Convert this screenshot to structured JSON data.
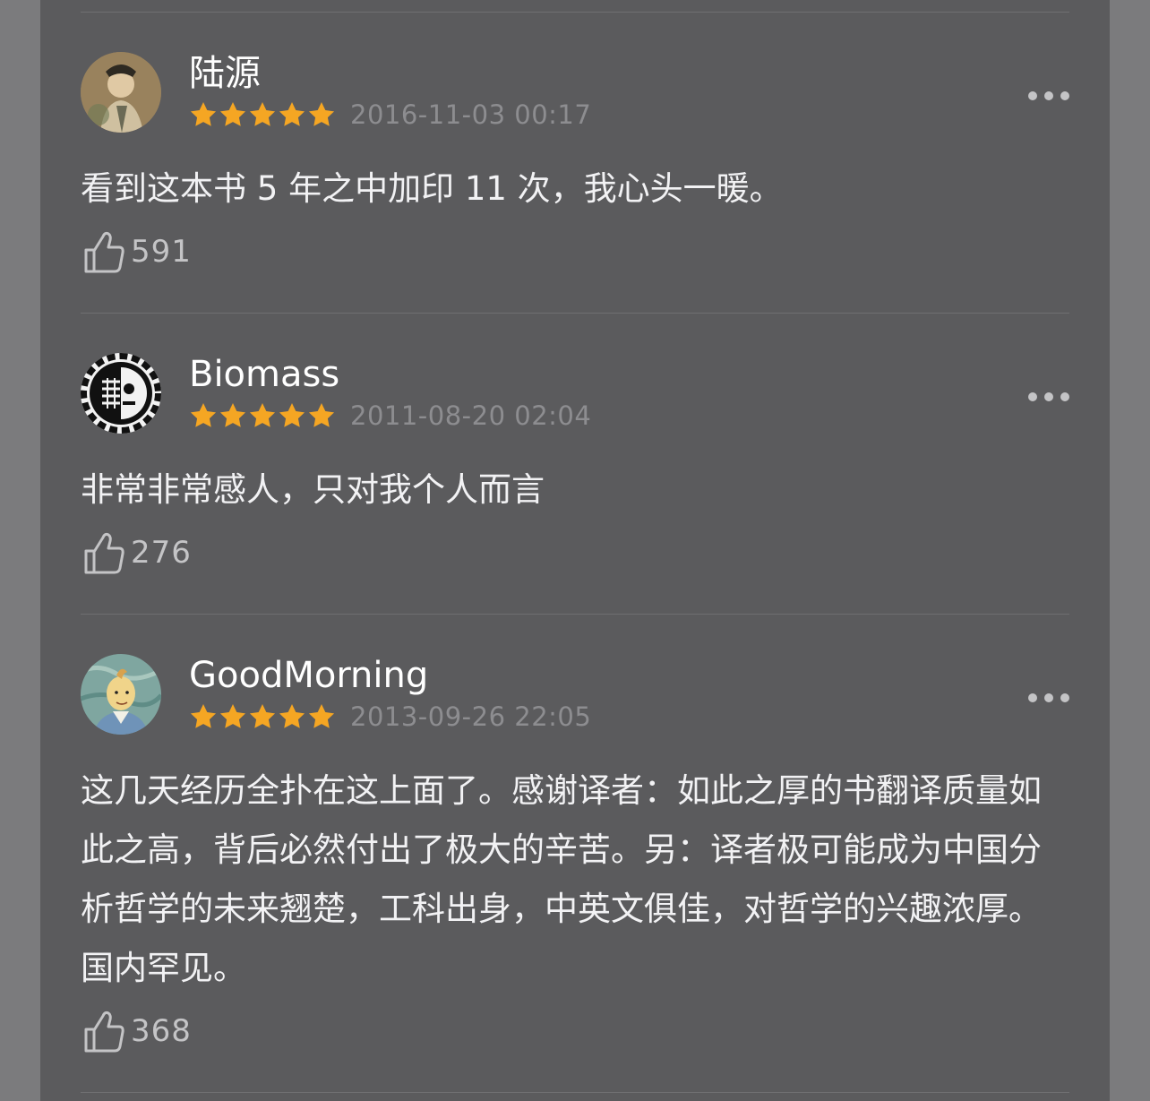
{
  "reviews": [
    {
      "username": "陆源",
      "rating": 5,
      "timestamp": "2016-11-03 00:17",
      "content": "看到这本书 5 年之中加印 11 次，我心头一暖。",
      "likes": "591",
      "avatar": "classical-painting-portrait-avatar"
    },
    {
      "username": "Biomass",
      "rating": 5,
      "timestamp": "2011-08-20 02:04",
      "content": "非常非常感人，只对我个人而言",
      "likes": "276",
      "avatar": "gear-skull-avatar"
    },
    {
      "username": "GoodMorning",
      "rating": 5,
      "timestamp": "2013-09-26 22:05",
      "content": "这几天经历全扑在这上面了。感谢译者：如此之厚的书翻译质量如此之高，背后必然付出了极大的辛苦。另：译者极可能成为中国分析哲学的未来翘楚，工科出身，中英文俱佳，对哲学的兴趣浓厚。国内罕见。",
      "likes": "368",
      "avatar": "tintin-portrait-avatar"
    }
  ],
  "colors": {
    "star": "#f5a623",
    "panel": "#5b5b5d",
    "backdrop": "#7b7b7d"
  }
}
